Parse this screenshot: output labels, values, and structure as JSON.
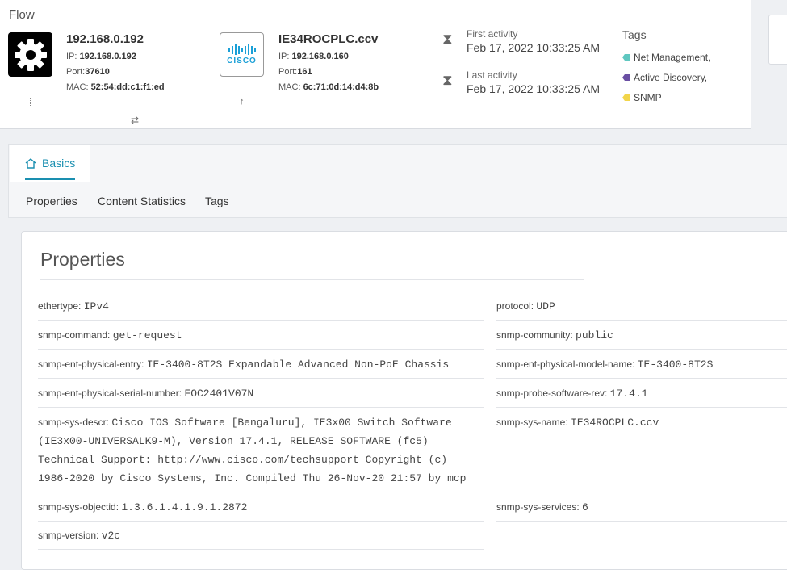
{
  "flow": {
    "title": "Flow",
    "source": {
      "name": "192.168.0.192",
      "ip_label": "IP:",
      "ip": "192.168.0.192",
      "port_label": "Port:",
      "port": "37610",
      "mac_label": "MAC:",
      "mac": "52:54:dd:c1:f1:ed",
      "icon": "gear-icon"
    },
    "destination": {
      "name": "IE34ROCPLC.ccv",
      "ip_label": "IP:",
      "ip": "192.168.0.160",
      "port_label": "Port:",
      "port": "161",
      "mac_label": "MAC:",
      "mac": "6c:71:0d:14:d4:8b",
      "icon": "cisco-logo-icon",
      "logo_text": "CISCO"
    },
    "first_activity": {
      "label": "First activity",
      "value": "Feb 17, 2022 10:33:25 AM"
    },
    "last_activity": {
      "label": "Last activity",
      "value": "Feb 17, 2022 10:33:25 AM"
    },
    "tags": {
      "label": "Tags",
      "items": [
        {
          "text": "Net Management,",
          "color": "#5fc7c0"
        },
        {
          "text": "Active Discovery,",
          "color": "#6a4fa3"
        },
        {
          "text": "SNMP",
          "color": "#f2d54a"
        }
      ]
    }
  },
  "tabs": {
    "active": "Basics",
    "subtabs": [
      "Properties",
      "Content Statistics",
      "Tags"
    ]
  },
  "properties": {
    "title": "Properties",
    "left": [
      {
        "key": "ethertype:",
        "value": "IPv4"
      },
      {
        "key": "snmp-command:",
        "value": "get-request"
      },
      {
        "key": "snmp-ent-physical-entry:",
        "value": "IE-3400-8T2S Expandable Advanced Non-PoE Chassis"
      },
      {
        "key": "snmp-ent-physical-serial-number:",
        "value": "FOC2401V07N"
      },
      {
        "key": "snmp-sys-descr:",
        "value": "Cisco IOS Software [Bengaluru], IE3x00 Switch Software",
        "value_cont": [
          "(IE3x00-UNIVERSALK9-M), Version 17.4.1, RELEASE SOFTWARE (fc5)",
          "Technical Support: http://www.cisco.com/techsupport Copyright (c)",
          "1986-2020 by Cisco Systems, Inc. Compiled Thu 26-Nov-20 21:57 by mcp"
        ]
      },
      {
        "key": "snmp-sys-objectid:",
        "value": "1.3.6.1.4.1.9.1.2872"
      },
      {
        "key": "snmp-version:",
        "value": "v2c"
      }
    ],
    "right": [
      {
        "key": "protocol:",
        "value": "UDP"
      },
      {
        "key": "snmp-community:",
        "value": "public"
      },
      {
        "key": "snmp-ent-physical-model-name:",
        "value": "IE-3400-8T2S"
      },
      {
        "key": "snmp-probe-software-rev:",
        "value": "17.4.1"
      },
      {
        "key": "snmp-sys-name:",
        "value": "IE34ROCPLC.ccv"
      },
      {
        "key": "snmp-sys-services:",
        "value": "6"
      }
    ]
  }
}
